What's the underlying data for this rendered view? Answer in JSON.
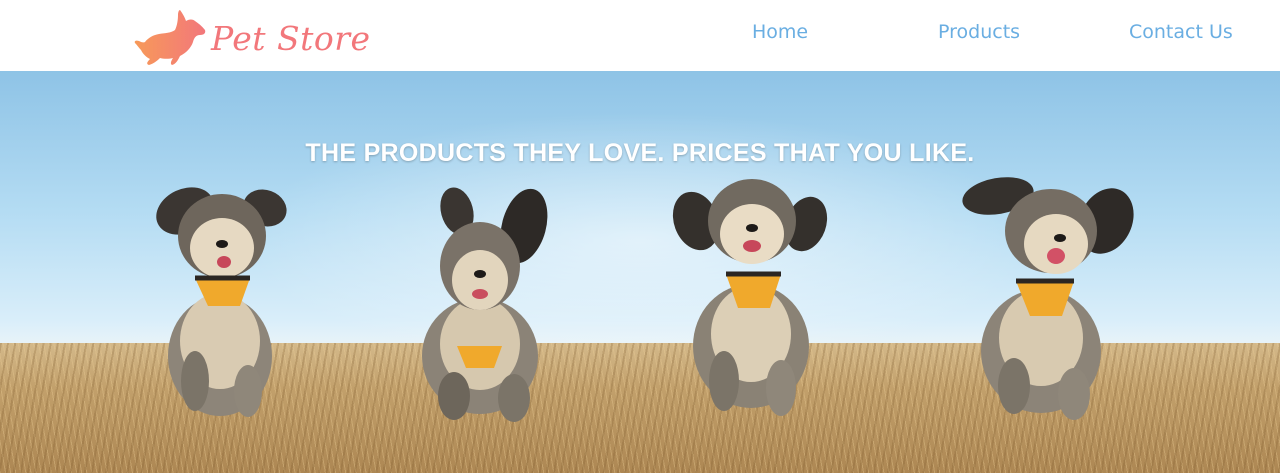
{
  "header": {
    "logo": {
      "text": "Pet Store",
      "icon": "running-dog-icon",
      "color": "#f2777b"
    },
    "nav": {
      "items": [
        {
          "id": "home",
          "label": "Home"
        },
        {
          "id": "products",
          "label": "Products"
        },
        {
          "id": "contact",
          "label": "Contact Us"
        }
      ],
      "link_color": "#6aaee2"
    }
  },
  "hero": {
    "tagline": "THE PRODUCTS THEY LOVE. PRICES THAT YOU LIKE.",
    "image": "four small dogs running across a dry grass field",
    "dog_icons": [
      "running-dog-icon",
      "running-dog-icon",
      "running-dog-icon",
      "running-dog-icon"
    ]
  }
}
